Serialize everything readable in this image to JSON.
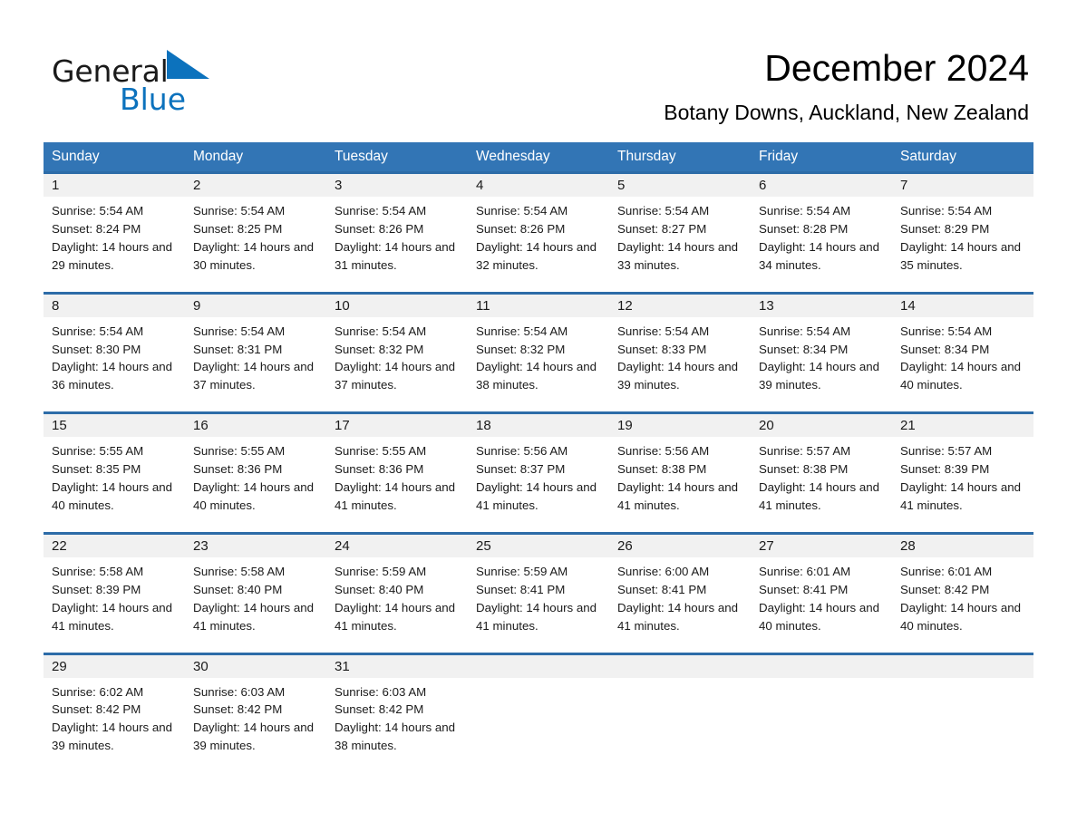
{
  "brand": {
    "name_part1": "General",
    "name_part2": "Blue",
    "triangle_color": "#0c72bd"
  },
  "header": {
    "title": "December 2024",
    "subtitle": "Botany Downs, Auckland, New Zealand"
  },
  "theme": {
    "header_blue": "#3275b5",
    "row_border_blue": "#2d6ca8",
    "daynum_band": "#f1f1f1"
  },
  "weekday_headers": [
    "Sunday",
    "Monday",
    "Tuesday",
    "Wednesday",
    "Thursday",
    "Friday",
    "Saturday"
  ],
  "weeks": [
    [
      {
        "day": "1",
        "sunrise": "Sunrise: 5:54 AM",
        "sunset": "Sunset: 8:24 PM",
        "daylight": "Daylight: 14 hours and 29 minutes."
      },
      {
        "day": "2",
        "sunrise": "Sunrise: 5:54 AM",
        "sunset": "Sunset: 8:25 PM",
        "daylight": "Daylight: 14 hours and 30 minutes."
      },
      {
        "day": "3",
        "sunrise": "Sunrise: 5:54 AM",
        "sunset": "Sunset: 8:26 PM",
        "daylight": "Daylight: 14 hours and 31 minutes."
      },
      {
        "day": "4",
        "sunrise": "Sunrise: 5:54 AM",
        "sunset": "Sunset: 8:26 PM",
        "daylight": "Daylight: 14 hours and 32 minutes."
      },
      {
        "day": "5",
        "sunrise": "Sunrise: 5:54 AM",
        "sunset": "Sunset: 8:27 PM",
        "daylight": "Daylight: 14 hours and 33 minutes."
      },
      {
        "day": "6",
        "sunrise": "Sunrise: 5:54 AM",
        "sunset": "Sunset: 8:28 PM",
        "daylight": "Daylight: 14 hours and 34 minutes."
      },
      {
        "day": "7",
        "sunrise": "Sunrise: 5:54 AM",
        "sunset": "Sunset: 8:29 PM",
        "daylight": "Daylight: 14 hours and 35 minutes."
      }
    ],
    [
      {
        "day": "8",
        "sunrise": "Sunrise: 5:54 AM",
        "sunset": "Sunset: 8:30 PM",
        "daylight": "Daylight: 14 hours and 36 minutes."
      },
      {
        "day": "9",
        "sunrise": "Sunrise: 5:54 AM",
        "sunset": "Sunset: 8:31 PM",
        "daylight": "Daylight: 14 hours and 37 minutes."
      },
      {
        "day": "10",
        "sunrise": "Sunrise: 5:54 AM",
        "sunset": "Sunset: 8:32 PM",
        "daylight": "Daylight: 14 hours and 37 minutes."
      },
      {
        "day": "11",
        "sunrise": "Sunrise: 5:54 AM",
        "sunset": "Sunset: 8:32 PM",
        "daylight": "Daylight: 14 hours and 38 minutes."
      },
      {
        "day": "12",
        "sunrise": "Sunrise: 5:54 AM",
        "sunset": "Sunset: 8:33 PM",
        "daylight": "Daylight: 14 hours and 39 minutes."
      },
      {
        "day": "13",
        "sunrise": "Sunrise: 5:54 AM",
        "sunset": "Sunset: 8:34 PM",
        "daylight": "Daylight: 14 hours and 39 minutes."
      },
      {
        "day": "14",
        "sunrise": "Sunrise: 5:54 AM",
        "sunset": "Sunset: 8:34 PM",
        "daylight": "Daylight: 14 hours and 40 minutes."
      }
    ],
    [
      {
        "day": "15",
        "sunrise": "Sunrise: 5:55 AM",
        "sunset": "Sunset: 8:35 PM",
        "daylight": "Daylight: 14 hours and 40 minutes."
      },
      {
        "day": "16",
        "sunrise": "Sunrise: 5:55 AM",
        "sunset": "Sunset: 8:36 PM",
        "daylight": "Daylight: 14 hours and 40 minutes."
      },
      {
        "day": "17",
        "sunrise": "Sunrise: 5:55 AM",
        "sunset": "Sunset: 8:36 PM",
        "daylight": "Daylight: 14 hours and 41 minutes."
      },
      {
        "day": "18",
        "sunrise": "Sunrise: 5:56 AM",
        "sunset": "Sunset: 8:37 PM",
        "daylight": "Daylight: 14 hours and 41 minutes."
      },
      {
        "day": "19",
        "sunrise": "Sunrise: 5:56 AM",
        "sunset": "Sunset: 8:38 PM",
        "daylight": "Daylight: 14 hours and 41 minutes."
      },
      {
        "day": "20",
        "sunrise": "Sunrise: 5:57 AM",
        "sunset": "Sunset: 8:38 PM",
        "daylight": "Daylight: 14 hours and 41 minutes."
      },
      {
        "day": "21",
        "sunrise": "Sunrise: 5:57 AM",
        "sunset": "Sunset: 8:39 PM",
        "daylight": "Daylight: 14 hours and 41 minutes."
      }
    ],
    [
      {
        "day": "22",
        "sunrise": "Sunrise: 5:58 AM",
        "sunset": "Sunset: 8:39 PM",
        "daylight": "Daylight: 14 hours and 41 minutes."
      },
      {
        "day": "23",
        "sunrise": "Sunrise: 5:58 AM",
        "sunset": "Sunset: 8:40 PM",
        "daylight": "Daylight: 14 hours and 41 minutes."
      },
      {
        "day": "24",
        "sunrise": "Sunrise: 5:59 AM",
        "sunset": "Sunset: 8:40 PM",
        "daylight": "Daylight: 14 hours and 41 minutes."
      },
      {
        "day": "25",
        "sunrise": "Sunrise: 5:59 AM",
        "sunset": "Sunset: 8:41 PM",
        "daylight": "Daylight: 14 hours and 41 minutes."
      },
      {
        "day": "26",
        "sunrise": "Sunrise: 6:00 AM",
        "sunset": "Sunset: 8:41 PM",
        "daylight": "Daylight: 14 hours and 41 minutes."
      },
      {
        "day": "27",
        "sunrise": "Sunrise: 6:01 AM",
        "sunset": "Sunset: 8:41 PM",
        "daylight": "Daylight: 14 hours and 40 minutes."
      },
      {
        "day": "28",
        "sunrise": "Sunrise: 6:01 AM",
        "sunset": "Sunset: 8:42 PM",
        "daylight": "Daylight: 14 hours and 40 minutes."
      }
    ],
    [
      {
        "day": "29",
        "sunrise": "Sunrise: 6:02 AM",
        "sunset": "Sunset: 8:42 PM",
        "daylight": "Daylight: 14 hours and 39 minutes."
      },
      {
        "day": "30",
        "sunrise": "Sunrise: 6:03 AM",
        "sunset": "Sunset: 8:42 PM",
        "daylight": "Daylight: 14 hours and 39 minutes."
      },
      {
        "day": "31",
        "sunrise": "Sunrise: 6:03 AM",
        "sunset": "Sunset: 8:42 PM",
        "daylight": "Daylight: 14 hours and 38 minutes."
      },
      {
        "day": "",
        "sunrise": "",
        "sunset": "",
        "daylight": ""
      },
      {
        "day": "",
        "sunrise": "",
        "sunset": "",
        "daylight": ""
      },
      {
        "day": "",
        "sunrise": "",
        "sunset": "",
        "daylight": ""
      },
      {
        "day": "",
        "sunrise": "",
        "sunset": "",
        "daylight": ""
      }
    ]
  ]
}
